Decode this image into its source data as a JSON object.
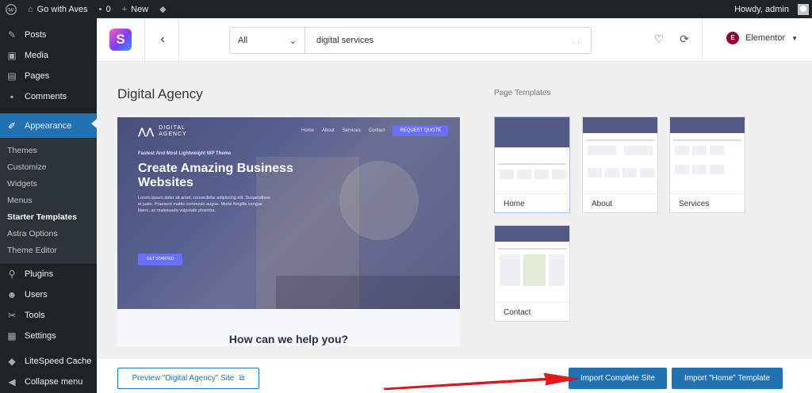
{
  "admin_bar": {
    "site_name": "Go with Aves",
    "comments_count": "0",
    "new_label": "New",
    "howdy": "Howdy, admin"
  },
  "sidebar": {
    "items": [
      {
        "label": "Posts",
        "icon": "pin-icon"
      },
      {
        "label": "Media",
        "icon": "media-icon"
      },
      {
        "label": "Pages",
        "icon": "pages-icon"
      },
      {
        "label": "Comments",
        "icon": "comment-icon"
      },
      {
        "label": "Appearance",
        "icon": "brush-icon"
      }
    ],
    "appearance_sub": [
      "Themes",
      "Customize",
      "Widgets",
      "Menus",
      "Starter Templates",
      "Astra Options",
      "Theme Editor"
    ],
    "items_after": [
      {
        "label": "Plugins",
        "icon": "plugin-icon"
      },
      {
        "label": "Users",
        "icon": "users-icon"
      },
      {
        "label": "Tools",
        "icon": "tools-icon"
      },
      {
        "label": "Settings",
        "icon": "settings-icon"
      },
      {
        "label": "LiteSpeed Cache",
        "icon": "litespeed-icon"
      }
    ],
    "collapse": "Collapse menu"
  },
  "topbar": {
    "filter_selected": "All",
    "search_value": "digital services",
    "search_dots": ". .",
    "builder": "Elementor",
    "builder_badge": "E"
  },
  "main": {
    "title": "Digital Agency",
    "page_templates_heading": "Page Templates"
  },
  "preview": {
    "brand_line1": "DIGITAL",
    "brand_line2": "AGENCY",
    "nav": [
      "Home",
      "About",
      "Services",
      "Contact"
    ],
    "cta": "REQUEST QUOTE",
    "kicker": "Fastest And Most Lightweight WP Theme",
    "headline": "Create Amazing Business Websites",
    "body": "Lorem ipsum dolor sit amet, consectetur adipiscing elit. Suspendisse et justo. Praesent mattis commodo augue. Morbi fringilla congue libero, ac malesuada vulputate pharetra.",
    "button": "GET STARTED",
    "help": "How can we help you?"
  },
  "templates": [
    {
      "label": "Home"
    },
    {
      "label": "About"
    },
    {
      "label": "Services"
    },
    {
      "label": "Contact"
    }
  ],
  "bottom": {
    "preview_btn": "Preview \"Digital Agency\" Site",
    "import_site": "Import Complete Site",
    "import_template": "Import \"Home\" Template"
  },
  "colors": {
    "wp_dark": "#1d2327",
    "wp_blue": "#2271b1",
    "arrow_red": "#e8151b"
  }
}
